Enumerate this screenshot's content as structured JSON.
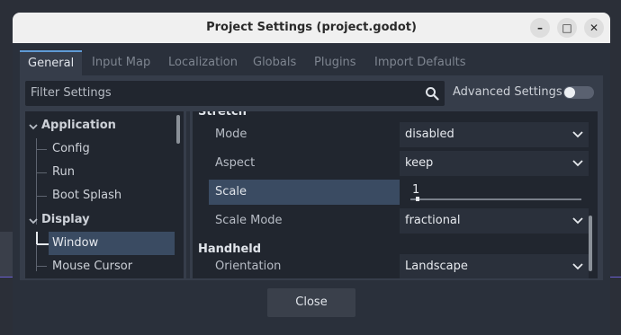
{
  "window": {
    "title": "Project Settings (project.godot)",
    "minimize_glyph": "–",
    "maximize_glyph": "□",
    "close_glyph": "✕"
  },
  "tabs": [
    "General",
    "Input Map",
    "Localization",
    "Globals",
    "Plugins",
    "Import Defaults"
  ],
  "active_tab": "General",
  "filter": {
    "placeholder": "Filter Settings"
  },
  "advanced_settings": {
    "label": "Advanced Settings",
    "enabled": false
  },
  "tree": {
    "items": [
      {
        "label": "Application",
        "type": "category"
      },
      {
        "label": "Config",
        "type": "item"
      },
      {
        "label": "Run",
        "type": "item"
      },
      {
        "label": "Boot Splash",
        "type": "item"
      },
      {
        "label": "Display",
        "type": "category"
      },
      {
        "label": "Window",
        "type": "item",
        "selected": true
      },
      {
        "label": "Mouse Cursor",
        "type": "item"
      }
    ]
  },
  "properties": {
    "sections": [
      {
        "label": "Stretch"
      },
      {
        "label": "Handheld"
      }
    ],
    "rows": [
      {
        "label": "Mode",
        "value": "disabled",
        "editor": "dropdown"
      },
      {
        "label": "Aspect",
        "value": "keep",
        "editor": "dropdown"
      },
      {
        "label": "Scale",
        "value": "1",
        "editor": "slider",
        "highlighted": true
      },
      {
        "label": "Scale Mode",
        "value": "fractional",
        "editor": "dropdown"
      },
      {
        "label": "Orientation",
        "value": "Landscape",
        "editor": "dropdown"
      }
    ]
  },
  "footer": {
    "close_label": "Close"
  },
  "colors": {
    "accent": "#5f9bd6",
    "selection": "#3a4b62",
    "panel": "#363d4a",
    "field": "#21262f"
  }
}
